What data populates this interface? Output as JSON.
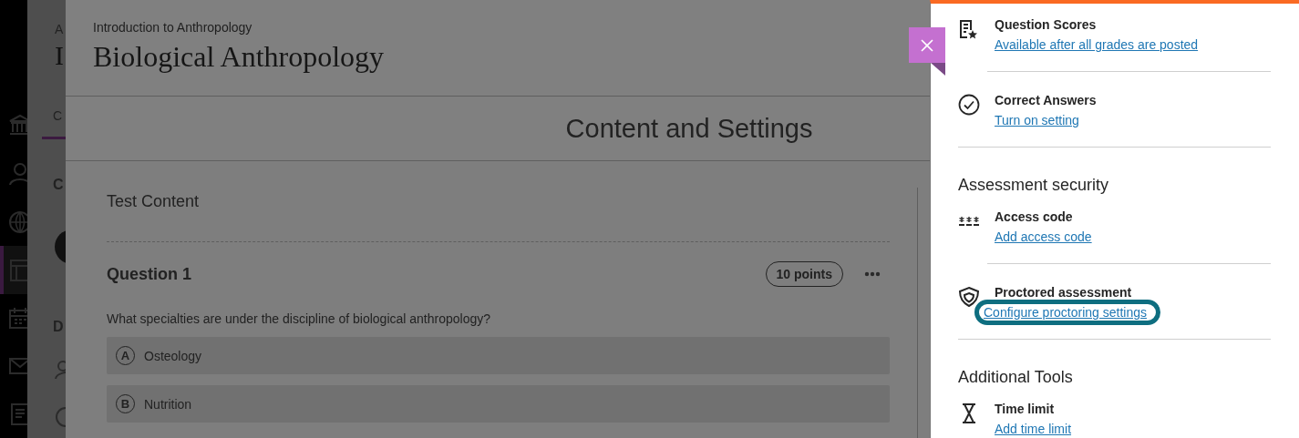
{
  "background_page": {
    "breadcrumb": "A",
    "title": "I",
    "tab": "C",
    "section_heading": "C",
    "section_heading_2": "D"
  },
  "side_nav": {
    "items": [
      {
        "selected": false
      },
      {
        "selected": false
      },
      {
        "selected": false
      },
      {
        "selected": true
      },
      {
        "selected": false
      },
      {
        "selected": false
      },
      {
        "selected": false
      }
    ]
  },
  "modal": {
    "course": "Introduction to Anthropology",
    "title": "Biological Anthropology",
    "page_heading": "Content and Settings",
    "content": {
      "heading": "Test Content",
      "question": {
        "title": "Question 1",
        "points": "10 points",
        "text": "What specialties are under the discipline of biological anthropology?",
        "answers": [
          {
            "letter": "A",
            "text": "Osteology"
          },
          {
            "letter": "B",
            "text": "Nutrition"
          }
        ]
      }
    }
  },
  "settings_panel": {
    "items": [
      {
        "kind": "setting",
        "title": "Question Scores",
        "link": "Available after all grades are posted",
        "focused": false
      },
      {
        "kind": "setting",
        "title": "Correct Answers",
        "link": "Turn on setting",
        "focused": false
      },
      {
        "kind": "heading",
        "title": "Assessment security"
      },
      {
        "kind": "setting",
        "title": "Access code",
        "link": "Add access code",
        "focused": false
      },
      {
        "kind": "setting",
        "title": "Proctored assessment",
        "link": "Configure proctoring settings",
        "focused": true
      },
      {
        "kind": "heading",
        "title": "Additional Tools"
      },
      {
        "kind": "setting",
        "title": "Time limit",
        "link": "Add time limit",
        "focused": false
      }
    ]
  }
}
